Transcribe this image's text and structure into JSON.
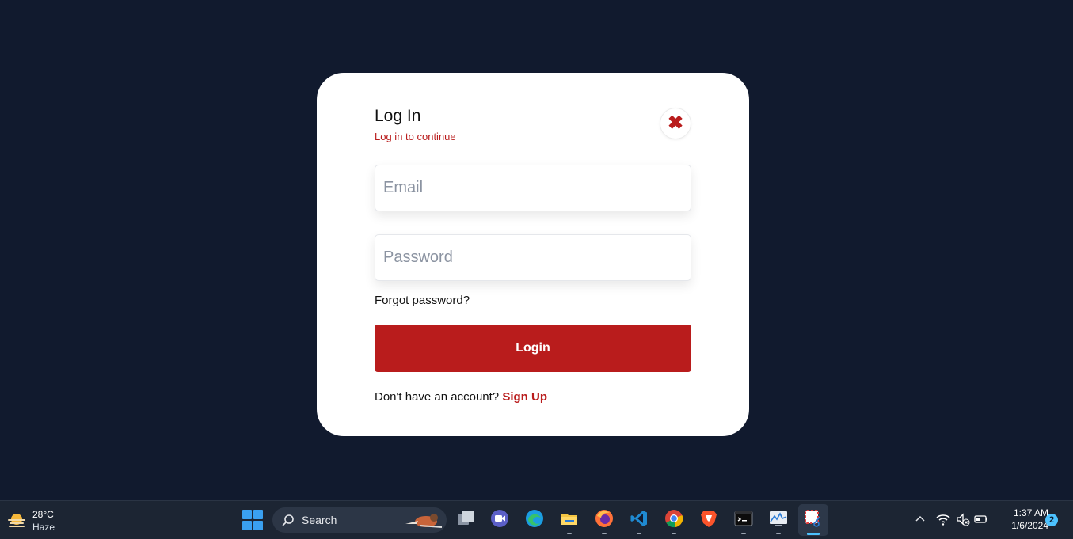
{
  "login": {
    "title": "Log In",
    "subtitle": "Log in to continue",
    "close_icon": "close-x-icon",
    "email_placeholder": "Email",
    "email_value": "",
    "password_placeholder": "Password",
    "password_value": "",
    "forgot_label": "Forgot password?",
    "login_label": "Login",
    "signup_prompt": "Don't have an account?",
    "signup_label": "Sign Up",
    "accent_color": "#b91c1c",
    "background_color": "#111a2e"
  },
  "taskbar": {
    "weather": {
      "temperature": "28°C",
      "condition": "Haze",
      "icon": "haze-sun-icon"
    },
    "search_label": "Search",
    "apps": [
      {
        "name": "task-view",
        "icon": "task-view-icon"
      },
      {
        "name": "teams-meet",
        "icon": "video-chat-icon"
      },
      {
        "name": "edge",
        "icon": "edge-browser-icon"
      },
      {
        "name": "file-explorer",
        "icon": "folder-icon"
      },
      {
        "name": "firefox",
        "icon": "firefox-icon"
      },
      {
        "name": "vscode",
        "icon": "vscode-icon"
      },
      {
        "name": "chrome",
        "icon": "chrome-icon"
      },
      {
        "name": "brave",
        "icon": "brave-icon"
      },
      {
        "name": "terminal",
        "icon": "terminal-icon"
      },
      {
        "name": "monitor",
        "icon": "resource-monitor-icon"
      },
      {
        "name": "snipping-tool",
        "icon": "snipping-tool-icon"
      }
    ],
    "clock": {
      "time": "1:37 AM",
      "date": "1/6/2024"
    },
    "notification_count": "2"
  }
}
